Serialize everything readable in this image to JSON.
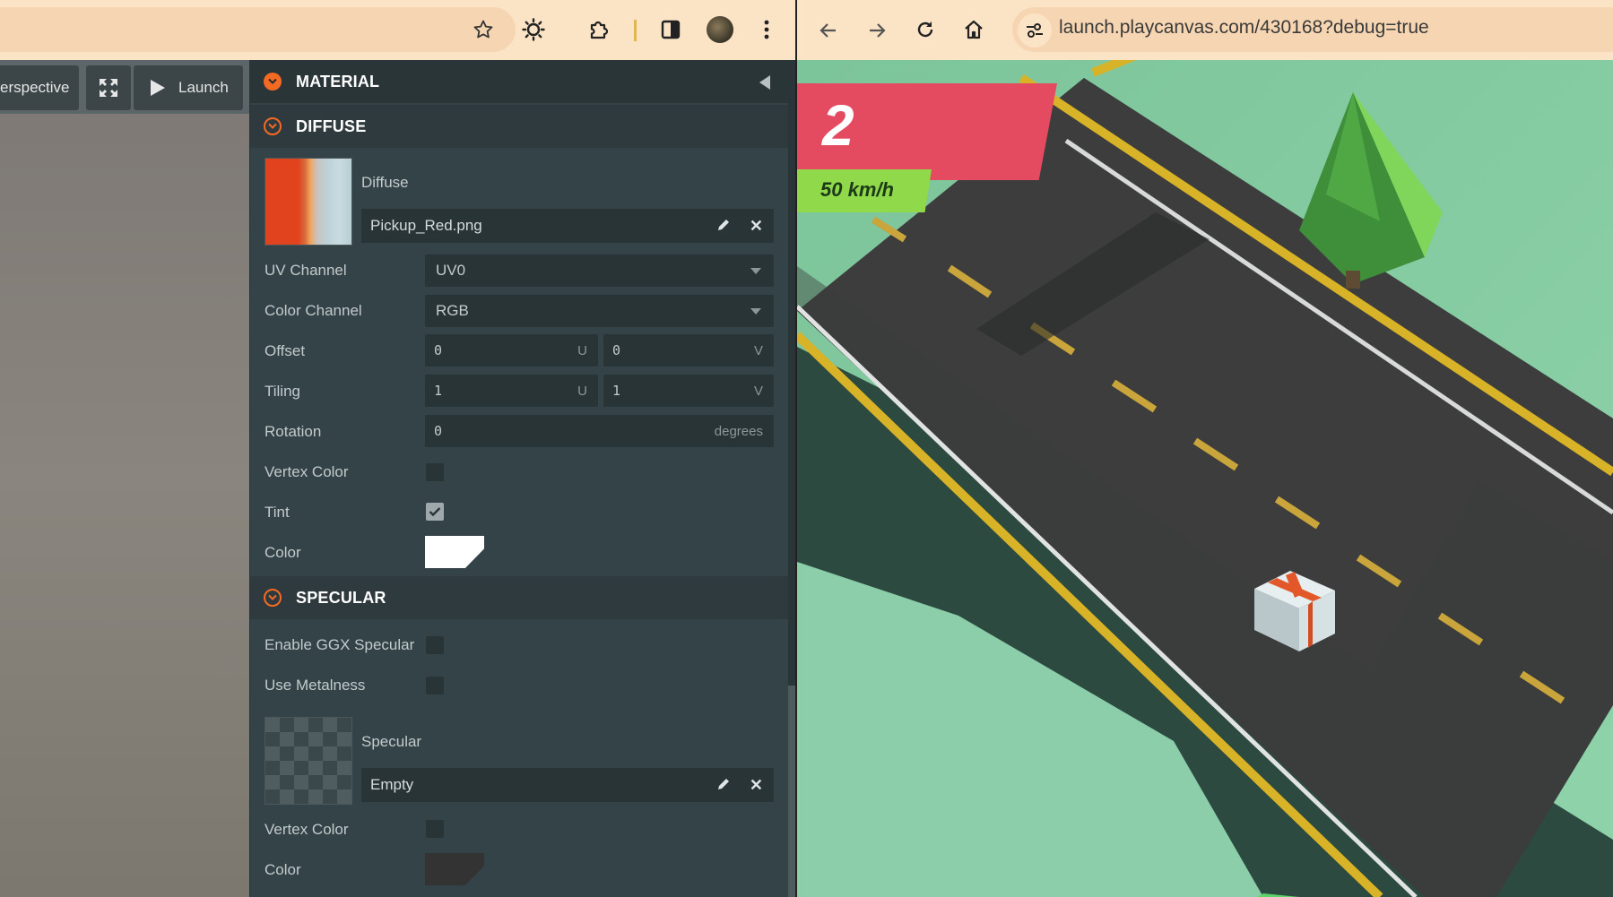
{
  "left_browser": {
    "toolbar_icons": [
      "star-icon",
      "sun-icon",
      "extensions-icon",
      "side-panel-icon",
      "profile-avatar",
      "more-vert-icon"
    ]
  },
  "viewport": {
    "camera_label": "erspective",
    "launch_label": "Launch"
  },
  "inspector": {
    "material_title": "MATERIAL",
    "diffuse": {
      "title": "DIFFUSE",
      "map_label": "Diffuse",
      "asset_name": "Pickup_Red.png",
      "uv_channel_label": "UV Channel",
      "uv_channel_value": "UV0",
      "color_channel_label": "Color Channel",
      "color_channel_value": "RGB",
      "offset_label": "Offset",
      "offset_u": "0",
      "offset_v": "0",
      "tiling_label": "Tiling",
      "tiling_u": "1",
      "tiling_v": "1",
      "rotation_label": "Rotation",
      "rotation_value": "0",
      "rotation_unit": "degrees",
      "vertex_color_label": "Vertex Color",
      "vertex_color_checked": false,
      "tint_label": "Tint",
      "tint_checked": true,
      "color_label": "Color",
      "color_value": "#ffffff",
      "u_suffix": "U",
      "v_suffix": "V"
    },
    "specular": {
      "title": "SPECULAR",
      "ggx_label": "Enable GGX Specular",
      "ggx_checked": false,
      "metalness_label": "Use Metalness",
      "metalness_checked": false,
      "map_label": "Specular",
      "asset_name": "Empty",
      "vertex_color_label": "Vertex Color",
      "vertex_color_checked": false,
      "color_label": "Color",
      "color_value": "#333333"
    }
  },
  "right_browser": {
    "nav_icons": [
      "back-icon",
      "forward-icon",
      "reload-icon",
      "home-icon",
      "site-settings-icon"
    ],
    "url": "launch.playcanvas.com/430168?debug=true"
  },
  "game": {
    "score": "2",
    "speed": "50 km/h"
  },
  "colors": {
    "accent": "#f56a23",
    "score_flag": "#e44b61",
    "speed_flag": "#8fd94a"
  }
}
